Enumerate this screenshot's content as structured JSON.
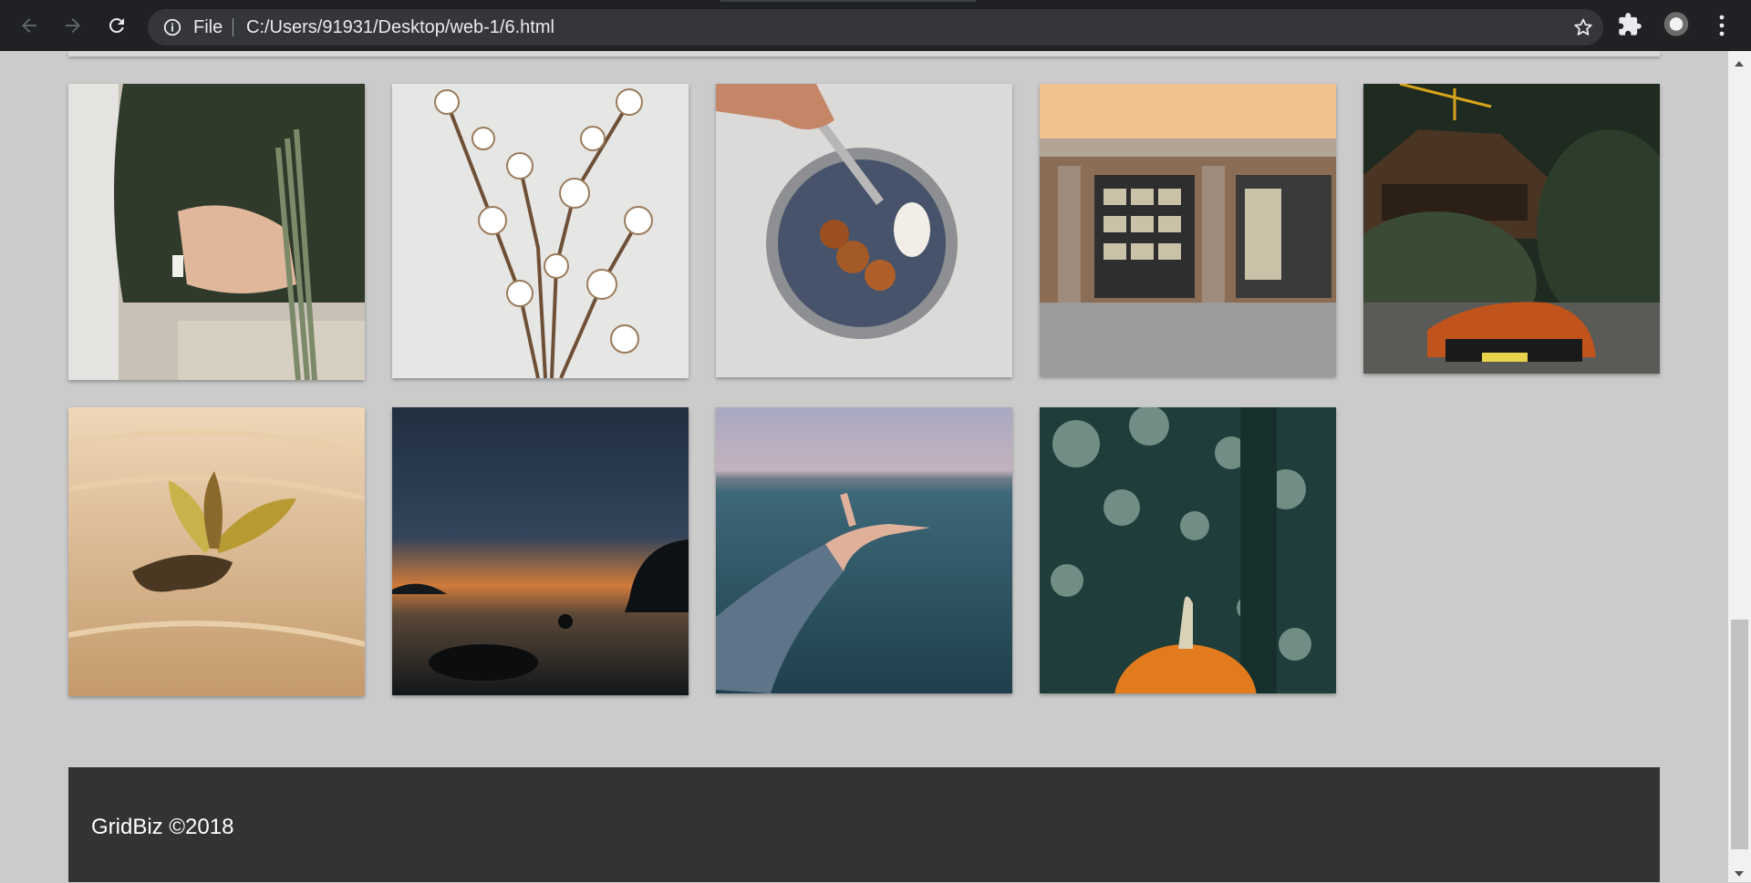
{
  "browser": {
    "file_label": "File",
    "url": "C:/Users/91931/Desktop/web-1/6.html"
  },
  "gallery": {
    "images": [
      {
        "description": "Person in green sweater holding dried grasses",
        "colors": [
          "#2f3a2b",
          "#4a5a3f",
          "#7d8a6a",
          "#c7c1b6"
        ]
      },
      {
        "description": "Dried cotton branches on white",
        "colors": [
          "#e6e6e4",
          "#d9d8d5",
          "#7a5a3c",
          "#ffffff"
        ]
      },
      {
        "description": "Dessert plate with pears and spoon",
        "colors": [
          "#d8d7d6",
          "#46536b",
          "#a35a26",
          "#ece9e6"
        ]
      },
      {
        "description": "Shop front with picture frames",
        "colors": [
          "#efc28f",
          "#8b6d56",
          "#3a3a3a",
          "#9c9b99"
        ]
      },
      {
        "description": "Chalet house and orange sports car",
        "colors": [
          "#1f2a20",
          "#3a4a34",
          "#c0541c",
          "#4a4e4a"
        ]
      },
      {
        "description": "Seedling growing from sand",
        "colors": [
          "#d9b892",
          "#c49a6c",
          "#8a6a2c",
          "#efd7b8"
        ]
      },
      {
        "description": "Sunset over water with dark clouds",
        "colors": [
          "#203041",
          "#34445a",
          "#d07a3a",
          "#121619"
        ]
      },
      {
        "description": "Arm reaching toward blue lake",
        "colors": [
          "#9aa4bd",
          "#2f5663",
          "#5e7488",
          "#dfb09a"
        ]
      },
      {
        "description": "Pumpkin with bokeh green background",
        "colors": [
          "#1f3d3a",
          "#3f6a5a",
          "#e27b1e",
          "#a9c3b7"
        ]
      }
    ]
  },
  "footer": {
    "text": "GridBiz ©2018"
  },
  "colors": {
    "page_bg": "#cbcbcb",
    "footer_bg": "#333333",
    "chrome_bg": "#202124"
  }
}
